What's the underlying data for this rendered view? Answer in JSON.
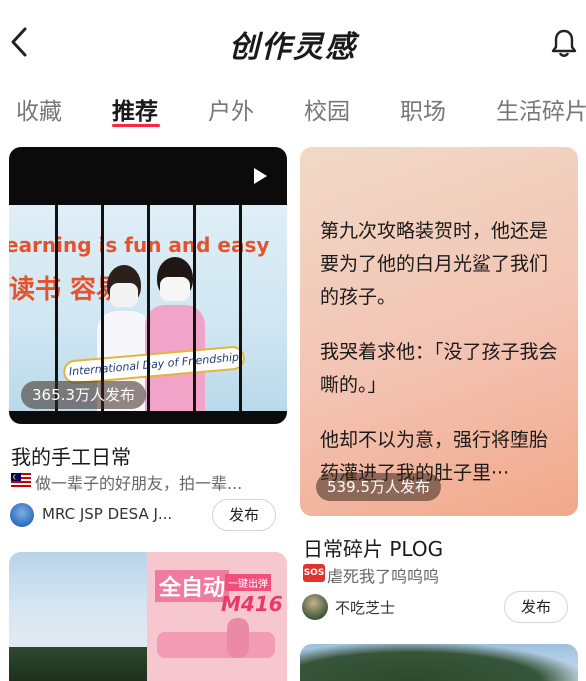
{
  "header": {
    "title": "创作灵感",
    "back_icon": "chevron-left-icon",
    "bell_icon": "bell-icon"
  },
  "tabs": [
    {
      "label": "收藏",
      "active": false
    },
    {
      "label": "推荐",
      "active": true
    },
    {
      "label": "户外",
      "active": false
    },
    {
      "label": "校园",
      "active": false
    },
    {
      "label": "职场",
      "active": false
    },
    {
      "label": "生活碎片",
      "active": false
    }
  ],
  "accent_color": "#ff2442",
  "cards": [
    {
      "kind": "video",
      "badge": "365.3万人发布",
      "title": "我的手工日常",
      "desc_flag": "malaysia-flag-icon",
      "desc": "做一辈子的好朋友，拍一辈...",
      "author": "MRC JSP DESA J...",
      "publish_label": "发布",
      "image_text": {
        "line1": "earning is fun and easy",
        "line2": "读书  容易",
        "banner": "International Day of Friendship"
      }
    },
    {
      "kind": "text",
      "badge": "539.5万人发布",
      "paragraphs": [
        "第九次攻略装贺时，他还是要为了他的白月光鲨了我们的孩子。",
        "我哭着求他：「没了孩子我会嘶的。」",
        "他却不以为意，强行将堕胎药灌进了我的肚子里···"
      ],
      "title": "日常碎片 PLOG",
      "desc_flag": "sos-icon",
      "desc": "虐死我了呜呜呜",
      "author": "不吃芝士",
      "publish_label": "发布"
    },
    {
      "kind": "image",
      "image_text": {
        "line1": "全自动",
        "line2": "M416",
        "tag": "一键出弹"
      }
    },
    {
      "kind": "image"
    }
  ]
}
